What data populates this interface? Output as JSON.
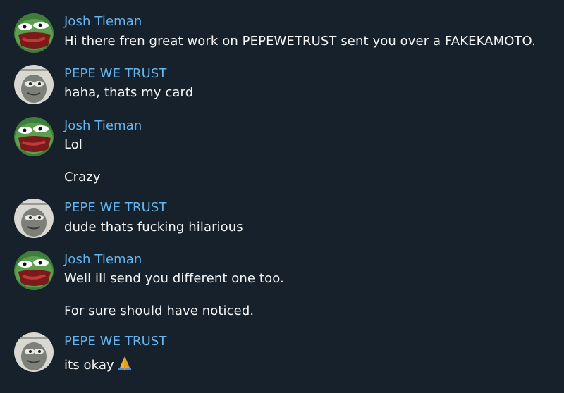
{
  "messages": [
    {
      "sender": "Josh Tieman",
      "avatar": "green-frog-avatar",
      "lines": [
        "Hi there fren great work on PEPEWETRUST sent you over a FAKEKAMOTO."
      ]
    },
    {
      "sender": "PEPE WE TRUST",
      "avatar": "gray-pepe-avatar",
      "lines": [
        "haha, thats my card"
      ]
    },
    {
      "sender": "Josh Tieman",
      "avatar": "green-frog-avatar",
      "lines": [
        "Lol",
        "Crazy"
      ]
    },
    {
      "sender": "PEPE WE TRUST",
      "avatar": "gray-pepe-avatar",
      "lines": [
        "dude thats fucking hilarious"
      ]
    },
    {
      "sender": "Josh Tieman",
      "avatar": "green-frog-avatar",
      "lines": [
        "Well ill send you different one too.",
        "For sure should have noticed."
      ]
    },
    {
      "sender": "PEPE WE TRUST",
      "avatar": "gray-pepe-avatar",
      "lines": [
        "its okay"
      ],
      "emoji": "folded-hands-icon"
    }
  ],
  "colors": {
    "background": "#17212b",
    "sender_name": "#64b5ef",
    "text": "#f5f5f5"
  }
}
